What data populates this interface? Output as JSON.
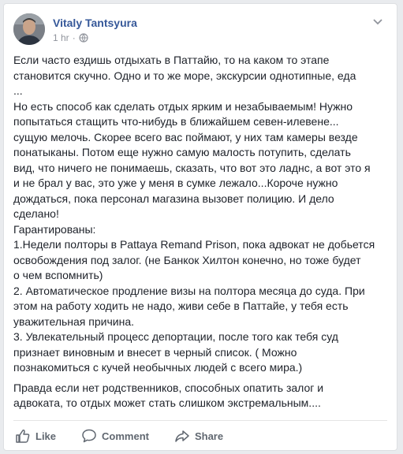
{
  "post": {
    "author": "Vitaly Tantsyura",
    "time": "1 hr",
    "separator": "·",
    "privacy_icon": "globe-icon",
    "menu_icon": "chevron-down-icon",
    "lines": [
      "Если часто ездишь отдыхать в Паттайю, то на каком то этапе",
      "становится скучно. Одно и то же море, экскурсии однотипные, еда",
      "...",
      "Но есть способ как сделать отдых ярким и незабываемым! Нужно",
      "попытаться стащить что-нибудь в ближайшем севен-илевене...",
      "сущую мелочь. Скорее всего вас поймают, у них там камеры везде",
      "понатыканы. Потом еще нужно самую малость потупить, сделать",
      "вид, что ничего не понимаешь, сказать, что вот это ладнс, а вот это я",
      "и не брал у вас, это уже у меня в сумке лежало...Короче нужно",
      "дождаться, пока персонал магазина вызовет полицию. И дело",
      "сделано!",
      "Гарантированы:",
      "1.Недели полторы в Pattaya Remand Prison, пока адвокат не добьется",
      "освобождения под залог. (не Банкок Хилтон конечно, но тоже будет",
      "о чем вспомнить)",
      "2. Автоматическое продление визы на полтора месяца до суда. При",
      "этом на работу ходить не надо, живи себе в Паттайе, у тебя есть",
      "уважительная причина.",
      "3. Увлекательный процесс депортации, после того как тебя суд",
      "признает виновным и внесет в черный список. ( Можно",
      "познакомиться с кучей необычных людей с всего мира.)"
    ],
    "closing_lines": [
      "Правда если нет родственников, способных опатить залог и",
      "адвоката, то отдых может стать слишком экстремальным...."
    ]
  },
  "actions": {
    "like": "Like",
    "comment": "Comment",
    "share": "Share"
  },
  "colors": {
    "author": "#365899",
    "text": "#1d2129",
    "muted": "#90949c",
    "action": "#606770"
  }
}
